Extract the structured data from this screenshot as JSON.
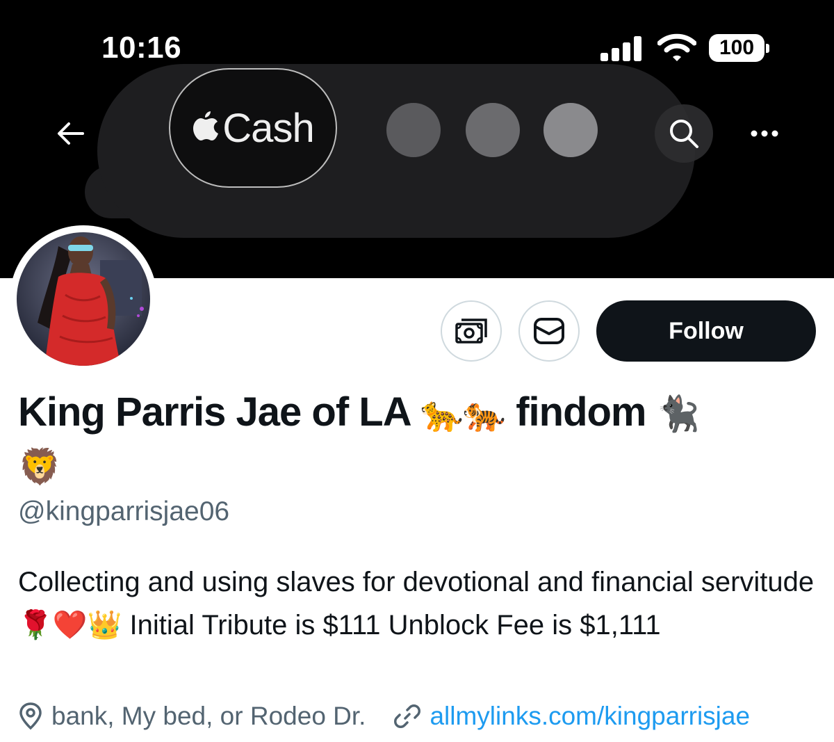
{
  "status_bar": {
    "time": "10:16",
    "battery": "100"
  },
  "banner": {
    "cash_label": "Cash"
  },
  "actions": {
    "follow_label": "Follow"
  },
  "profile": {
    "name_part1": "King Parris Jae of LA",
    "name_emoji1": "🐆🐅",
    "name_part2": "findom",
    "name_emoji2": "🐈‍⬛",
    "name_emoji3": "🦁",
    "handle": "@kingparrisjae06",
    "bio_part1": "Collecting and using slaves for devotional and financial servitude",
    "bio_emojis": "🌹❤️👑",
    "bio_part2": "Initial Tribute is $111 Unblock Fee is $1,111",
    "location": "bank, My bed, or Rodeo Dr.",
    "link": "allmylinks.com/kingparrisjae"
  },
  "icons": [
    "back-arrow-icon",
    "search-icon",
    "more-icon",
    "tip-money-icon",
    "envelope-icon",
    "location-pin-icon",
    "link-icon",
    "apple-logo-icon"
  ],
  "colors": {
    "banner_bg": "#000000",
    "follow_bg": "#0f1419",
    "handle_gray": "#536471",
    "link_blue": "#1d9bf0",
    "dress_red": "#d42a2a"
  }
}
